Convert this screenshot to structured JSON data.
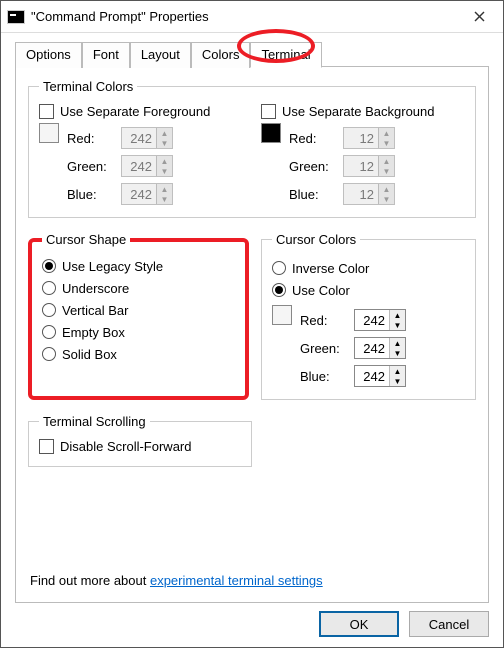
{
  "title": "\"Command Prompt\" Properties",
  "tabs": [
    "Options",
    "Font",
    "Layout",
    "Colors",
    "Terminal"
  ],
  "active_tab_index": 4,
  "terminal_colors": {
    "legend": "Terminal Colors",
    "fg_label": "Use Separate Foreground",
    "bg_label": "Use Separate Background",
    "fg_checked": false,
    "bg_checked": false,
    "red_label": "Red:",
    "green_label": "Green:",
    "blue_label": "Blue:",
    "fg": {
      "red": "242",
      "green": "242",
      "blue": "242"
    },
    "bg": {
      "red": "12",
      "green": "12",
      "blue": "12"
    }
  },
  "cursor_shape": {
    "legend": "Cursor Shape",
    "options": [
      "Use Legacy Style",
      "Underscore",
      "Vertical Bar",
      "Empty Box",
      "Solid Box"
    ],
    "selected_index": 0
  },
  "cursor_colors": {
    "legend": "Cursor Colors",
    "inverse_label": "Inverse Color",
    "use_color_label": "Use Color",
    "selected": "use_color",
    "red_label": "Red:",
    "green_label": "Green:",
    "blue_label": "Blue:",
    "rgb": {
      "red": "242",
      "green": "242",
      "blue": "242"
    }
  },
  "scrolling": {
    "legend": "Terminal Scrolling",
    "disable_label": "Disable Scroll-Forward",
    "checked": false
  },
  "footer": {
    "prefix": "Find out more about ",
    "link": "experimental terminal settings"
  },
  "buttons": {
    "ok": "OK",
    "cancel": "Cancel"
  }
}
